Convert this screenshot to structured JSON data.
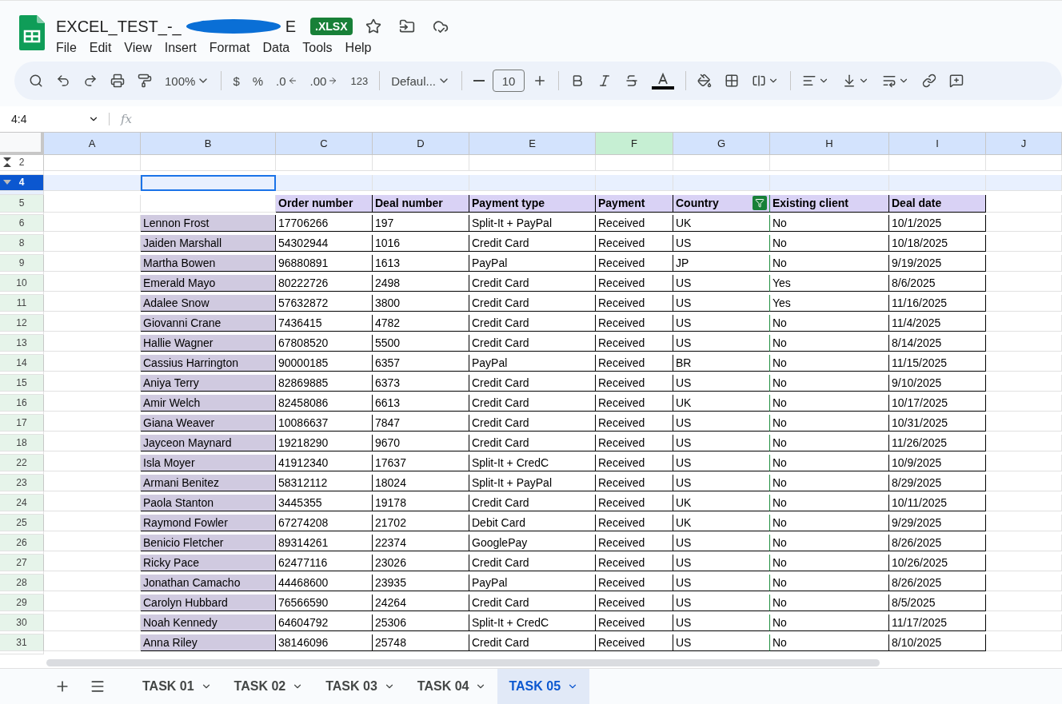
{
  "document": {
    "title": "EXCEL_TEST_-_",
    "title_tail": "E",
    "badge": ".XLSX"
  },
  "menu": [
    "File",
    "Edit",
    "View",
    "Insert",
    "Format",
    "Data",
    "Tools",
    "Help"
  ],
  "toolbar": {
    "zoom": "100%",
    "currency": "$",
    "percent": "%",
    "decrease_decimals": ".0",
    "increase_decimals": ".00",
    "number_format": "123",
    "font": "Defaul...",
    "font_size": "10"
  },
  "name_box": "4:4",
  "formula_label": "fx",
  "columns": [
    {
      "label": "A",
      "filtered": false
    },
    {
      "label": "B",
      "filtered": false
    },
    {
      "label": "C",
      "filtered": false
    },
    {
      "label": "D",
      "filtered": false
    },
    {
      "label": "E",
      "filtered": false
    },
    {
      "label": "F",
      "filtered": true
    },
    {
      "label": "G",
      "filtered": false
    },
    {
      "label": "H",
      "filtered": false
    },
    {
      "label": "I",
      "filtered": false
    },
    {
      "label": "J",
      "filtered": false
    }
  ],
  "rows": [
    {
      "number": "2",
      "kind": "spacer",
      "selected": false,
      "cells": []
    },
    {
      "number": "4",
      "kind": "spacer",
      "selected": true,
      "cells": []
    },
    {
      "number": "5",
      "kind": "header",
      "selected": false,
      "cells": [
        "Order number",
        "Deal number",
        "Payment type",
        "Payment",
        "Country",
        "Existing client",
        "Deal date"
      ]
    },
    {
      "number": "6",
      "kind": "record",
      "selected": false,
      "cells": [
        "Lennon Frost",
        "17706266",
        "197",
        "Split-It + PayPal",
        "Received",
        "UK",
        "No",
        "10/1/2025"
      ]
    },
    {
      "number": "8",
      "kind": "record",
      "selected": false,
      "cells": [
        "Jaiden Marshall",
        "54302944",
        "1016",
        "Credit Card",
        "Received",
        "US",
        "No",
        "10/18/2025"
      ]
    },
    {
      "number": "9",
      "kind": "record",
      "selected": false,
      "cells": [
        "Martha Bowen",
        "96880891",
        "1613",
        "PayPal",
        "Received",
        "JP",
        "No",
        "9/19/2025"
      ]
    },
    {
      "number": "10",
      "kind": "record",
      "selected": false,
      "cells": [
        "Emerald Mayo",
        "80222726",
        "2498",
        "Credit Card",
        "Received",
        "US",
        "Yes",
        "8/6/2025"
      ]
    },
    {
      "number": "11",
      "kind": "record",
      "selected": false,
      "cells": [
        "Adalee Snow",
        "57632872",
        "3800",
        "Credit Card",
        "Received",
        "US",
        "Yes",
        "11/16/2025"
      ]
    },
    {
      "number": "12",
      "kind": "record",
      "selected": false,
      "cells": [
        "Giovanni Crane",
        "7436415",
        "4782",
        "Credit Card",
        "Received",
        "US",
        "No",
        "11/4/2025"
      ]
    },
    {
      "number": "13",
      "kind": "record",
      "selected": false,
      "cells": [
        "Hallie Wagner",
        "67808520",
        "5500",
        "Credit Card",
        "Received",
        "US",
        "No",
        "8/14/2025"
      ]
    },
    {
      "number": "14",
      "kind": "record",
      "selected": false,
      "cells": [
        "Cassius Harrington",
        "90000185",
        "6357",
        "PayPal",
        "Received",
        "BR",
        "No",
        "11/15/2025"
      ]
    },
    {
      "number": "15",
      "kind": "record",
      "selected": false,
      "cells": [
        "Aniya Terry",
        "82869885",
        "6373",
        "Credit Card",
        "Received",
        "US",
        "No",
        "9/10/2025"
      ]
    },
    {
      "number": "16",
      "kind": "record",
      "selected": false,
      "cells": [
        "Amir Welch",
        "82458086",
        "6613",
        "Credit Card",
        "Received",
        "UK",
        "No",
        "10/17/2025"
      ]
    },
    {
      "number": "17",
      "kind": "record",
      "selected": false,
      "cells": [
        "Giana Weaver",
        "10086637",
        "7847",
        "Credit Card",
        "Received",
        "US",
        "No",
        "10/31/2025"
      ]
    },
    {
      "number": "18",
      "kind": "record",
      "selected": false,
      "cells": [
        "Jayceon Maynard",
        "19218290",
        "9670",
        "Credit Card",
        "Received",
        "US",
        "No",
        "11/26/2025"
      ]
    },
    {
      "number": "22",
      "kind": "record",
      "selected": false,
      "cells": [
        "Isla Moyer",
        "41912340",
        "17637",
        "Split-It + CredC",
        "Received",
        "US",
        "No",
        "10/9/2025"
      ]
    },
    {
      "number": "23",
      "kind": "record",
      "selected": false,
      "cells": [
        "Armani Benitez",
        "58312112",
        "18024",
        "Split-It + PayPal",
        "Received",
        "US",
        "No",
        "8/29/2025"
      ]
    },
    {
      "number": "24",
      "kind": "record",
      "selected": false,
      "cells": [
        "Paola Stanton",
        "3445355",
        "19178",
        "Credit Card",
        "Received",
        "UK",
        "No",
        "10/11/2025"
      ]
    },
    {
      "number": "25",
      "kind": "record",
      "selected": false,
      "cells": [
        "Raymond Fowler",
        "67274208",
        "21702",
        "Debit Card",
        "Received",
        "UK",
        "No",
        "9/29/2025"
      ]
    },
    {
      "number": "26",
      "kind": "record",
      "selected": false,
      "cells": [
        "Benicio Fletcher",
        "89314261",
        "22374",
        "GooglePay",
        "Received",
        "US",
        "No",
        "8/26/2025"
      ]
    },
    {
      "number": "27",
      "kind": "record",
      "selected": false,
      "cells": [
        "Ricky Pace",
        "62477116",
        "23026",
        "Credit Card",
        "Received",
        "US",
        "No",
        "10/26/2025"
      ]
    },
    {
      "number": "28",
      "kind": "record",
      "selected": false,
      "cells": [
        "Jonathan Camacho",
        "44468600",
        "23935",
        "PayPal",
        "Received",
        "US",
        "No",
        "8/26/2025"
      ]
    },
    {
      "number": "29",
      "kind": "record",
      "selected": false,
      "cells": [
        "Carolyn Hubbard",
        "76566590",
        "24264",
        "Credit Card",
        "Received",
        "US",
        "No",
        "8/5/2025"
      ]
    },
    {
      "number": "30",
      "kind": "record",
      "selected": false,
      "cells": [
        "Noah Kennedy",
        "64604792",
        "25306",
        "Split-It + CredC",
        "Received",
        "US",
        "No",
        "11/17/2025"
      ]
    },
    {
      "number": "31",
      "kind": "record",
      "selected": false,
      "cells": [
        "Anna Riley",
        "38146096",
        "25748",
        "Credit Card",
        "Received",
        "US",
        "No",
        "8/10/2025"
      ]
    }
  ],
  "sheets": [
    {
      "label": "TASK 01",
      "selected": false
    },
    {
      "label": "TASK 02",
      "selected": false
    },
    {
      "label": "TASK 03",
      "selected": false
    },
    {
      "label": "TASK 04",
      "selected": false
    },
    {
      "label": "TASK 05",
      "selected": true
    }
  ]
}
